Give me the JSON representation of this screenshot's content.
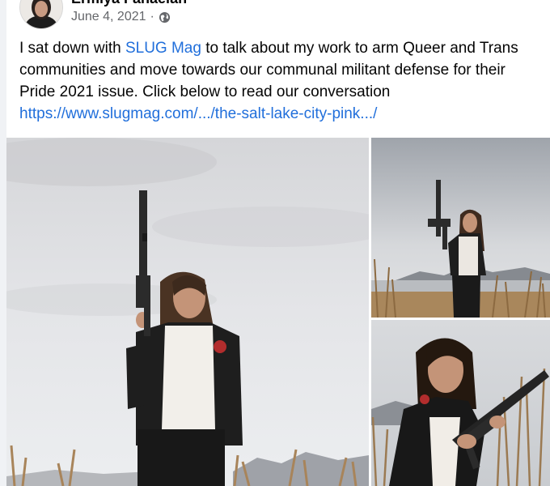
{
  "post": {
    "author": "Ermiya Fanaeian",
    "date": "June 4, 2021",
    "separator": "·",
    "audience_icon": "globe-icon",
    "text_before": "I sat down with ",
    "mention": "SLUG Mag",
    "text_after": " to talk about my work to arm Queer and Trans communities and move towards our communal militant defense for their Pride 2021 issue. Click below to read our conversation",
    "link": "https://www.slugmag.com/.../the-salt-lake-city-pink.../"
  },
  "colors": {
    "link": "#216fdb",
    "meta": "#65676b",
    "text": "#050505"
  }
}
